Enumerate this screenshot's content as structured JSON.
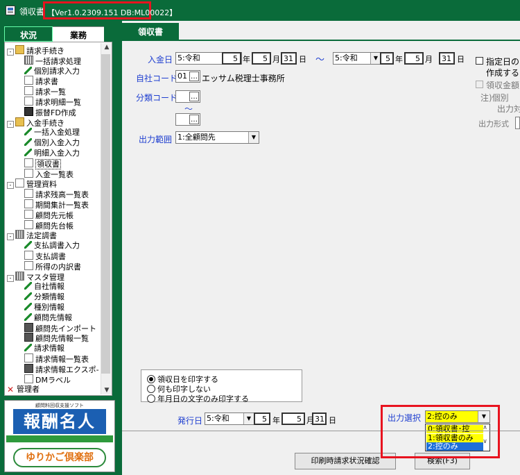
{
  "window": {
    "title": "領収書",
    "version": "【Ver1.0.2309.151  DB:ML00022】"
  },
  "left_tabs": {
    "status": "状況",
    "business": "業務"
  },
  "tree": [
    {
      "label": "請求手続き",
      "indent": 0,
      "expander": "-",
      "icon": "folder-icon"
    },
    {
      "label": "一括請求処理",
      "indent": 1,
      "icon": "grid-icon"
    },
    {
      "label": "個別請求入力",
      "indent": 1,
      "icon": "pen-icon"
    },
    {
      "label": "請求書",
      "indent": 1,
      "icon": "document-icon"
    },
    {
      "label": "請求一覧",
      "indent": 1,
      "icon": "document-icon"
    },
    {
      "label": "請求明細一覧",
      "indent": 1,
      "icon": "document-icon"
    },
    {
      "label": "振替FD作成",
      "indent": 1,
      "icon": "floppy-icon"
    },
    {
      "label": "入金手続き",
      "indent": 0,
      "expander": "-",
      "icon": "folder-icon"
    },
    {
      "label": "一括入金処理",
      "indent": 1,
      "icon": "pen-icon"
    },
    {
      "label": "個別入金入力",
      "indent": 1,
      "icon": "pen-icon"
    },
    {
      "label": "明細入金入力",
      "indent": 1,
      "icon": "pen-icon"
    },
    {
      "label": "領収書",
      "indent": 1,
      "icon": "document-icon",
      "selected": true
    },
    {
      "label": "入金一覧表",
      "indent": 1,
      "icon": "document-icon"
    },
    {
      "label": "管理資料",
      "indent": 0,
      "expander": "-",
      "icon": "document-icon"
    },
    {
      "label": "請求残高一覧表",
      "indent": 1,
      "icon": "document-icon"
    },
    {
      "label": "期間集計一覧表",
      "indent": 1,
      "icon": "document-icon"
    },
    {
      "label": "顧問先元帳",
      "indent": 1,
      "icon": "document-icon"
    },
    {
      "label": "顧問先台帳",
      "indent": 1,
      "icon": "document-icon"
    },
    {
      "label": "法定調書",
      "indent": 0,
      "expander": "-",
      "icon": "bars-icon"
    },
    {
      "label": "支払調書入力",
      "indent": 1,
      "icon": "pen-icon"
    },
    {
      "label": "支払調書",
      "indent": 1,
      "icon": "document-icon"
    },
    {
      "label": "所得の内訳書",
      "indent": 1,
      "icon": "document-icon"
    },
    {
      "label": "マスタ管理",
      "indent": 0,
      "expander": "-",
      "icon": "bars-icon"
    },
    {
      "label": "自社情報",
      "indent": 1,
      "icon": "pen-icon"
    },
    {
      "label": "分類情報",
      "indent": 1,
      "icon": "pen-icon"
    },
    {
      "label": "種別情報",
      "indent": 1,
      "icon": "pen-icon"
    },
    {
      "label": "顧問先情報",
      "indent": 1,
      "icon": "pen-icon"
    },
    {
      "label": "顧問先インポート",
      "indent": 1,
      "icon": "import-icon"
    },
    {
      "label": "顧問先情報一覧",
      "indent": 1,
      "icon": "import-icon"
    },
    {
      "label": "請求情報",
      "indent": 1,
      "icon": "pen-icon"
    },
    {
      "label": "請求情報一覧表",
      "indent": 1,
      "icon": "document-icon"
    },
    {
      "label": "請求情報エクスポ-",
      "indent": 1,
      "icon": "import-icon"
    },
    {
      "label": "DMラベル",
      "indent": 1,
      "icon": "document-icon"
    },
    {
      "label": "管理者",
      "indent": 0,
      "icon": "x-icon"
    }
  ],
  "logo": {
    "top_text": "顧問料回収支援ソフト",
    "main": "報酬名人",
    "sub": "ゆりかご倶楽部"
  },
  "main_tab": "領収書",
  "form": {
    "deposit_date_label": "入金日",
    "era_from": "5:令和",
    "year_from": "5",
    "month_from": "5",
    "day_from": "31",
    "tilde": "～",
    "era_to": "5:令和",
    "year_to": "5",
    "month_to": "5",
    "day_to": "31",
    "unit_year": "年",
    "unit_month": "月",
    "unit_day": "日",
    "company_code_label": "自社コード",
    "company_code": "01",
    "company_name": "エッサム税理士事務所",
    "category_code_label": "分類コード",
    "output_range_label": "出力範囲",
    "output_range": "1:全顧問先",
    "right_chk1_line1": "指定日の",
    "right_chk1_line2": "作成する",
    "right_chk2_line1": "領収金額",
    "right_note1": "注)個別",
    "right_note2": "出力対",
    "output_format_label": "出力形式",
    "dots": "…"
  },
  "print_options": [
    {
      "label": "領収日を印字する",
      "checked": true
    },
    {
      "label": "何も印字しない",
      "checked": false
    },
    {
      "label": "年月日の文字のみ印字する",
      "checked": false
    }
  ],
  "issue": {
    "label": "発行日",
    "era": "5:令和",
    "year": "5",
    "month": "5",
    "day": "31"
  },
  "output_select": {
    "label": "出力選択",
    "value": "2:控のみ",
    "options": [
      "0:領収書･控",
      "1:領収書のみ",
      "2:控のみ"
    ]
  },
  "buttons": {
    "print_status": "印刷時請求状況確認",
    "search": "検索(F3)"
  }
}
